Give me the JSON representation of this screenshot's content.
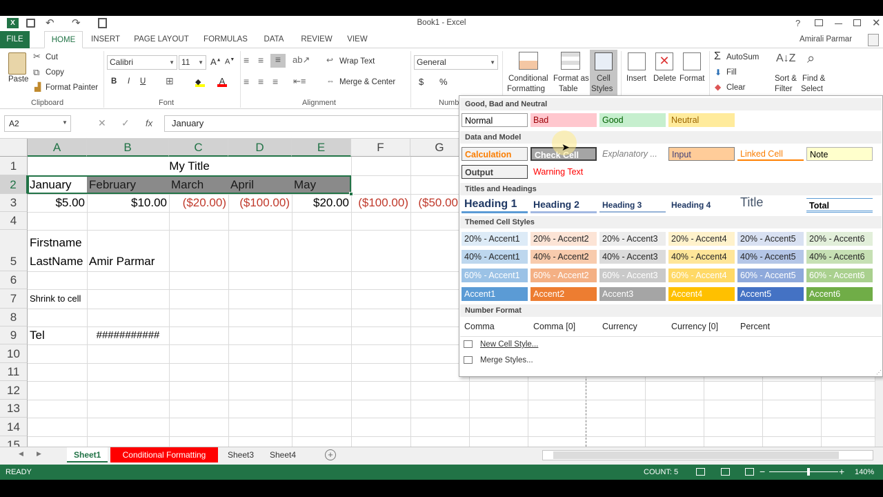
{
  "window": {
    "title": "Book1 - Excel",
    "user": "Amirali Parmar"
  },
  "tabs": {
    "file": "FILE",
    "home": "HOME",
    "insert": "INSERT",
    "page_layout": "PAGE LAYOUT",
    "formulas": "FORMULAS",
    "data": "DATA",
    "review": "REVIEW",
    "view": "VIEW"
  },
  "ribbon": {
    "clipboard": {
      "paste": "Paste",
      "cut": "Cut",
      "copy": "Copy",
      "format_painter": "Format Painter",
      "label": "Clipboard"
    },
    "font": {
      "name": "Calibri",
      "size": "11",
      "label": "Font",
      "bold": "B",
      "italic": "I",
      "underline": "U"
    },
    "alignment": {
      "wrap": "Wrap Text",
      "merge": "Merge & Center",
      "label": "Alignment"
    },
    "number": {
      "format": "General",
      "label": "Numb",
      "currency": "$",
      "percent": "%"
    },
    "styles": {
      "conditional": "Conditional",
      "conditional2": "Formatting",
      "format_as": "Format as",
      "format_as2": "Table",
      "cell": "Cell",
      "cell2": "Styles"
    },
    "cells": {
      "insert": "Insert",
      "delete": "Delete",
      "format": "Format"
    },
    "editing": {
      "autosum": "AutoSum",
      "fill": "Fill",
      "clear": "Clear",
      "sort": "Sort &",
      "sort2": "Filter",
      "find": "Find &",
      "find2": "Select"
    }
  },
  "formula_bar": {
    "name_box": "A2",
    "content": "January",
    "fx": "fx"
  },
  "columns": [
    "A",
    "B",
    "C",
    "D",
    "E",
    "F",
    "G"
  ],
  "rows": [
    "1",
    "2",
    "3",
    "4",
    "5",
    "6",
    "7",
    "8",
    "9",
    "10",
    "11",
    "12",
    "13",
    "14",
    "15"
  ],
  "cells": {
    "A1": "My Title",
    "A2": "January",
    "B2": "February",
    "C2": "March",
    "D2": "April",
    "E2": "May",
    "A3": "$5.00",
    "B3": "$10.00",
    "C3": "($20.00)",
    "D3": "($100.00)",
    "E3": "$20.00",
    "F3": "($100.00)",
    "G3": "($50.00",
    "A5a": "Firstname",
    "A5": "LastName",
    "B5": "Amir Parmar",
    "A7": "Shrink to cell",
    "A9": "Tel",
    "B9": "###########"
  },
  "sheets": [
    "Sheet1",
    "Conditional Formatting",
    "Sheet3",
    "Sheet4"
  ],
  "status": {
    "ready": "READY",
    "count": "COUNT: 5",
    "zoom": "140%"
  },
  "gallery": {
    "sections": {
      "good_bad": "Good, Bad and Neutral",
      "data_model": "Data and Model",
      "titles": "Titles and Headings",
      "themed": "Themed Cell Styles",
      "number": "Number Format"
    },
    "good_bad": [
      "Normal",
      "Bad",
      "Good",
      "Neutral"
    ],
    "data_model_1": [
      "Calculation",
      "Check Cell",
      "Explanatory ...",
      "Input",
      "Linked Cell",
      "Note"
    ],
    "data_model_2": [
      "Output",
      "Warning Text"
    ],
    "titles": [
      "Heading 1",
      "Heading 2",
      "Heading 3",
      "Heading 4",
      "Title",
      "Total"
    ],
    "themed_20": [
      "20% - Accent1",
      "20% - Accent2",
      "20% - Accent3",
      "20% - Accent4",
      "20% - Accent5",
      "20% - Accent6"
    ],
    "themed_40": [
      "40% - Accent1",
      "40% - Accent2",
      "40% - Accent3",
      "40% - Accent4",
      "40% - Accent5",
      "40% - Accent6"
    ],
    "themed_60": [
      "60% - Accent1",
      "60% - Accent2",
      "60% - Accent3",
      "60% - Accent4",
      "60% - Accent5",
      "60% - Accent6"
    ],
    "accents": [
      "Accent1",
      "Accent2",
      "Accent3",
      "Accent4",
      "Accent5",
      "Accent6"
    ],
    "number": [
      "Comma",
      "Comma [0]",
      "Currency",
      "Currency [0]",
      "Percent"
    ],
    "menu": [
      "New Cell Style...",
      "Merge Styles..."
    ]
  },
  "colors": {
    "excel_green": "#217346",
    "accent1": "#5b9bd5",
    "accent2": "#ed7d31",
    "accent3": "#a5a5a5",
    "accent4": "#ffc000",
    "accent5": "#4472c4",
    "accent6": "#70ad47",
    "red_tab": "#ff0000"
  }
}
